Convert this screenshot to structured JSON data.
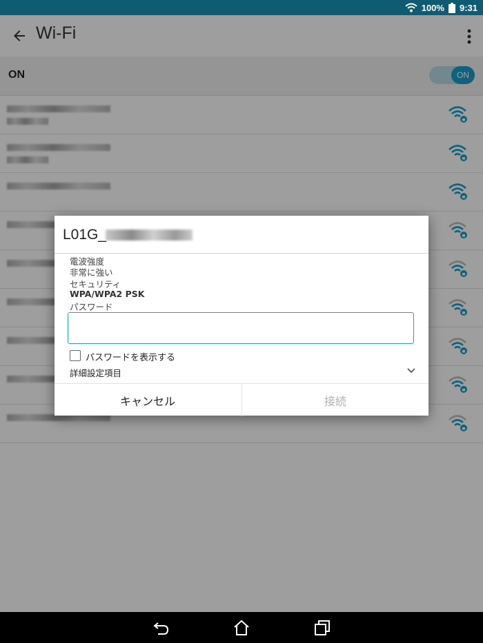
{
  "status_bar": {
    "battery": "100%",
    "time": "9:31"
  },
  "app_bar": {
    "title": "Wi-Fi"
  },
  "wifi_toggle": {
    "label": "ON",
    "switch_text": "ON"
  },
  "networks": [
    {
      "signal": "strong"
    },
    {
      "signal": "strong"
    },
    {
      "signal": "strong"
    },
    {
      "signal": "medium"
    },
    {
      "signal": "medium"
    },
    {
      "signal": "medium"
    },
    {
      "signal": "medium"
    },
    {
      "signal": "medium"
    },
    {
      "signal": "medium"
    }
  ],
  "dialog": {
    "title": "L01G_",
    "signal_label": "電波強度",
    "signal_value": "非常に強い",
    "security_label": "セキュリティ",
    "security_value": "WPA/WPA2 PSK",
    "password_label": "パスワード",
    "password_value": "",
    "show_password_label": "パスワードを表示する",
    "advanced_label": "詳細設定項目",
    "cancel_label": "キャンセル",
    "connect_label": "接続"
  },
  "colors": {
    "accent": "#1a9fc9",
    "status_bar": "#0f5c72"
  },
  "icons": [
    "wifi-icon",
    "back-arrow-icon",
    "overflow-menu-icon",
    "chevron-down-icon",
    "nav-back-icon",
    "nav-home-icon",
    "nav-recents-icon"
  ]
}
